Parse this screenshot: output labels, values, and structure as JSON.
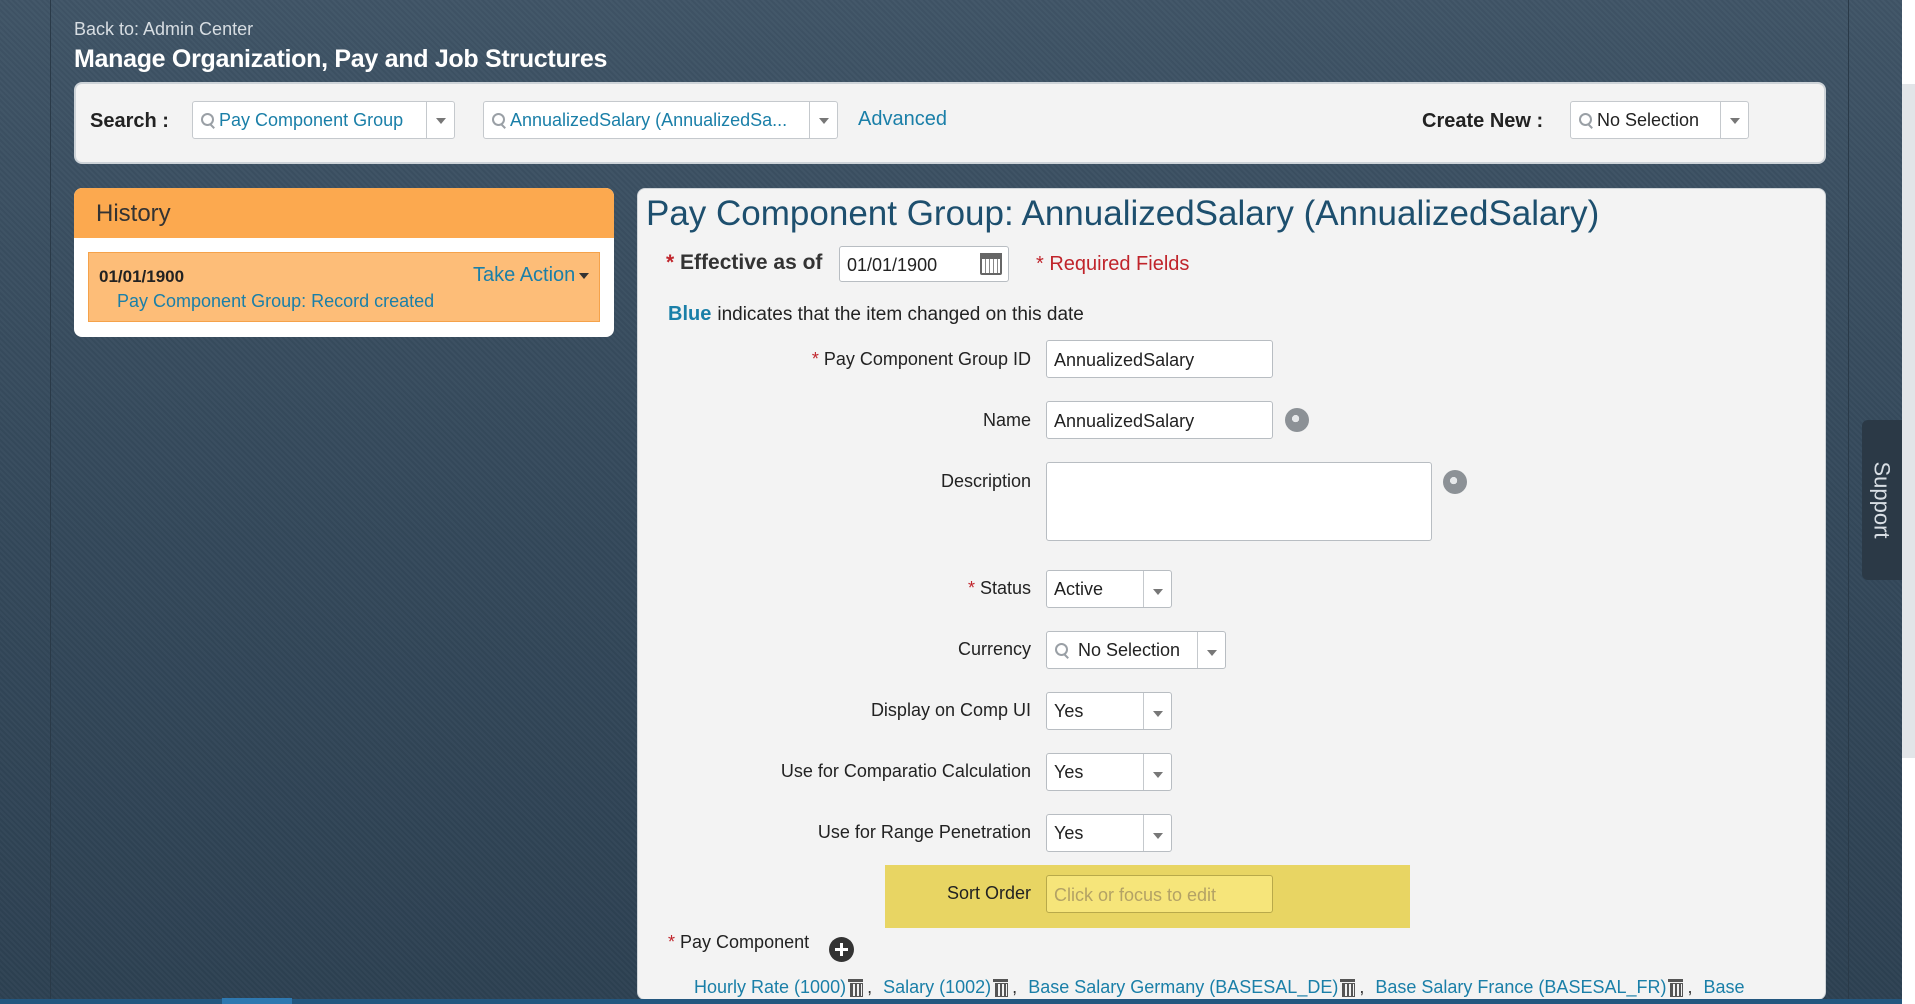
{
  "header": {
    "back_link": "Back to: Admin Center",
    "title": "Manage Organization, Pay and Job Structures"
  },
  "search_bar": {
    "search_label": "Search :",
    "type_combo": "Pay Component Group",
    "item_combo": "AnnualizedSalary (AnnualizedSa...",
    "advanced_link": "Advanced",
    "create_new_label": "Create New :",
    "create_new_combo": "No Selection"
  },
  "history": {
    "title": "History",
    "entry_date": "01/01/1900",
    "take_action": "Take Action",
    "entry_record": "Pay Component Group: Record created"
  },
  "detail": {
    "title": "Pay Component Group: AnnualizedSalary (AnnualizedSalary)",
    "required_star": "*",
    "effective_label": "Effective as of",
    "effective_date": "01/01/1900",
    "required_fields": "* Required Fields",
    "blue_word": "Blue",
    "blue_note": "indicates that the item changed on this date",
    "fields": {
      "group_id_label": "Pay Component Group ID",
      "group_id_value": "AnnualizedSalary",
      "name_label": "Name",
      "name_value": "AnnualizedSalary",
      "description_label": "Description",
      "status_label": "Status",
      "status_value": "Active",
      "currency_label": "Currency",
      "currency_value": "No Selection",
      "display_comp_label": "Display on Comp UI",
      "display_comp_value": "Yes",
      "comparatio_label": "Use for Comparatio Calculation",
      "comparatio_value": "Yes",
      "range_label": "Use for Range Penetration",
      "range_value": "Yes",
      "sort_order_label": "Sort Order",
      "sort_order_placeholder": "Click or focus to edit"
    },
    "pay_component_label": "Pay Component",
    "pay_components": [
      "Hourly Rate (1000)",
      "Salary (1002)",
      "Base Salary Germany (BASESAL_DE)",
      "Base Salary France (BASESAL_FR)",
      "Base"
    ]
  },
  "support_tab": "Support",
  "colors": {
    "history_header": "#fca94f",
    "history_item": "#fdbd78",
    "link_blue": "#1a7fa8",
    "required_red": "#c0242b",
    "sort_highlight": "#e8d563"
  }
}
